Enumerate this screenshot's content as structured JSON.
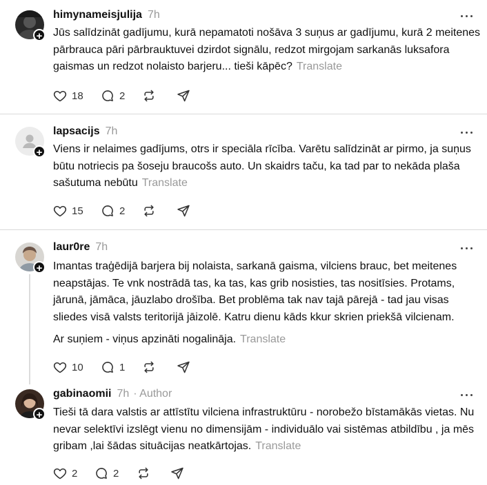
{
  "posts": [
    {
      "username": "himynameisjulija",
      "time": "7h",
      "text": [
        "Jūs salīdzināt gadījumu, kurā nepamatoti nošāva 3 suņus ar gadījumu, kurā 2 meitenes pārbrauca pāri pārbrauktuvei dzirdot signālu, redzot mirgojam sarkanās luksafora gaismas un redzot nolaisto barjeru... tieši kāpēc?"
      ],
      "translate": "Translate",
      "likes": "18",
      "replies": "2"
    },
    {
      "username": "lapsacijs",
      "time": "7h",
      "text": [
        "Viens ir nelaimes gadījums, otrs ir speciāla rīcība. Varētu salīdzināt ar pirmo, ja suņus būtu notriecis pa šoseju braucošs auto. Un skaidrs taču, ka tad par to nekāda plaša sašutuma nebūtu"
      ],
      "translate": "Translate",
      "likes": "15",
      "replies": "2"
    },
    {
      "username": "laur0re",
      "time": "7h",
      "text": [
        "Imantas traģēdijā barjera bij nolaista, sarkanā gaisma, vilciens brauc, bet meitenes neapstājas. Te vnk nostrādā tas, ka tas, kas grib nosisties, tas nositīsies. Protams, jārunā, jāmāca, jāuzlabo drošība. Bet problēma tak nav tajā pārejā - tad jau visas sliedes visā valsts teritorijā jāizolē. Katru dienu kāds kkur skrien priekšā vilcienam.",
        "Ar suņiem - viņus apzināti nogalināja."
      ],
      "translate": "Translate",
      "likes": "10",
      "replies": "1"
    },
    {
      "username": "gabinaomii",
      "time": "7h",
      "author_tag": "· Author",
      "text": [
        "Tieši tā dara valstis ar attīstītu vilciena infrastruktūru - norobežo bīstamākās vietas. Nu nevar selektīvi izslēgt vienu no dimensijām - individuālo vai sistēmas atbildību , ja mēs gribam ,lai šādas situācijas neatkārtojas."
      ],
      "translate": "Translate",
      "likes": "2",
      "replies": "2"
    }
  ],
  "icons": [
    "heart-icon",
    "comment-icon",
    "repost-icon",
    "share-icon",
    "more-icon",
    "follow-plus-icon"
  ],
  "colors": {
    "text": "#101010",
    "muted": "#999999",
    "divider": "#d9d9d9",
    "thread_line": "#dcdcdc"
  }
}
